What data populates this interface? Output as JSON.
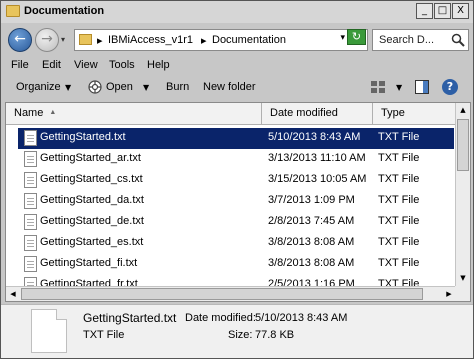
{
  "window": {
    "title": "Documentation",
    "controls": {
      "minimize": "_",
      "maximize": "□",
      "close": "X"
    }
  },
  "nav": {
    "back_glyph": "←",
    "forward_glyph": "→",
    "history_glyph": "▾",
    "breadcrumb_sep": "▸",
    "breadcrumbs": [
      "IBMiAccess_v1r1",
      "Documentation"
    ],
    "address_dropdown_glyph": "▾",
    "refresh_glyph": "↻",
    "search_placeholder": "Search D..."
  },
  "menu": [
    "File",
    "Edit",
    "View",
    "Tools",
    "Help"
  ],
  "toolbar": {
    "organize": "Organize",
    "open": "Open",
    "burn": "Burn",
    "new_folder": "New folder",
    "dropdown_glyph": "▼",
    "help_glyph": "?"
  },
  "columns": {
    "name": "Name",
    "date_modified": "Date modified",
    "type": "Type",
    "sort_glyph": "▲"
  },
  "files": [
    {
      "name": "GettingStarted.txt",
      "date": "5/10/2013 8:43 AM",
      "type": "TXT File",
      "selected": true
    },
    {
      "name": "GettingStarted_ar.txt",
      "date": "3/13/2013 11:10 AM",
      "type": "TXT File",
      "selected": false
    },
    {
      "name": "GettingStarted_cs.txt",
      "date": "3/15/2013 10:05 AM",
      "type": "TXT File",
      "selected": false
    },
    {
      "name": "GettingStarted_da.txt",
      "date": "3/7/2013 1:09 PM",
      "type": "TXT File",
      "selected": false
    },
    {
      "name": "GettingStarted_de.txt",
      "date": "2/8/2013 7:45 AM",
      "type": "TXT File",
      "selected": false
    },
    {
      "name": "GettingStarted_es.txt",
      "date": "3/8/2013 8:08 AM",
      "type": "TXT File",
      "selected": false
    },
    {
      "name": "GettingStarted_fi.txt",
      "date": "3/8/2013 8:08 AM",
      "type": "TXT File",
      "selected": false
    },
    {
      "name": "GettingStarted_fr.txt",
      "date": "2/5/2013 1:16 PM",
      "type": "TXT File",
      "selected": false
    }
  ],
  "scroll_glyphs": {
    "up": "▲",
    "down": "▼",
    "left": "◀",
    "right": "▶"
  },
  "details": {
    "filename": "GettingStarted.txt",
    "date_label": "Date modified:",
    "date_value": "5/10/2013 8:43 AM",
    "type": "TXT File",
    "size_label": "Size:",
    "size_value": "77.8 KB"
  },
  "colors": {
    "selection": "#0a246a",
    "window_chrome": "#c7c7c7"
  }
}
